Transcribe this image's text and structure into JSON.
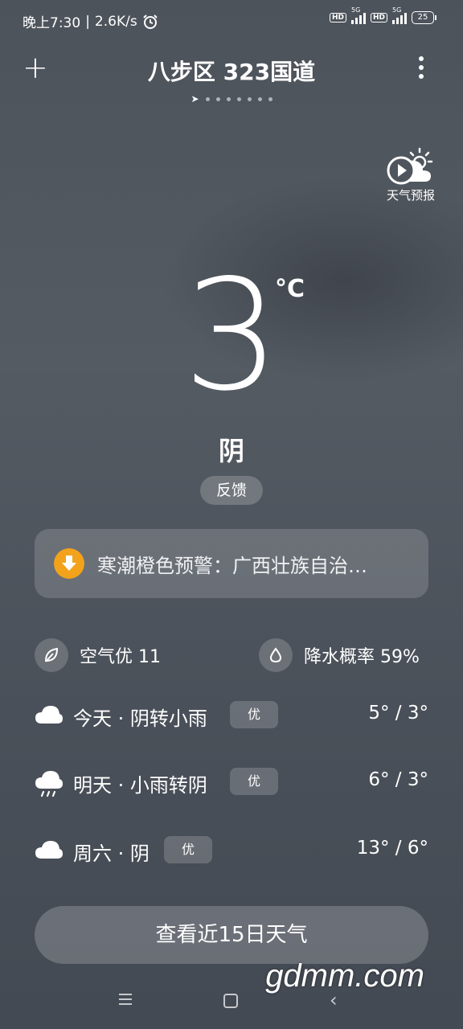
{
  "status": {
    "time": "晚上7:30",
    "speed": "2.6K/s",
    "hd1": "HD",
    "net1": "5G",
    "hd2": "HD",
    "net2": "5G",
    "battery": "25"
  },
  "header": {
    "title": "八步区 323国道"
  },
  "forecast_button": {
    "label": "天气预报"
  },
  "current": {
    "temperature": "3",
    "unit": "°C",
    "condition": "阴",
    "feedback": "反馈"
  },
  "alert": {
    "text": "寒潮橙色预警：广西壮族自治…"
  },
  "metrics": {
    "air": "空气优 11",
    "rain": "降水概率 59%"
  },
  "days": [
    {
      "label": "今天 · 阴转小雨",
      "quality": "优",
      "temp": "5° / 3°",
      "icon": "cloud-icon"
    },
    {
      "label": "明天 · 小雨转阴",
      "quality": "优",
      "temp": "6° / 3°",
      "icon": "rain-cloud-icon"
    },
    {
      "label": "周六 · 阴",
      "quality": "优",
      "temp": "13° / 6°",
      "icon": "cloud-icon"
    }
  ],
  "fifteen_day_button": "查看近15日天气",
  "watermark": "gdmm.com",
  "colors": {
    "alert_icon": "#f2a21b"
  }
}
